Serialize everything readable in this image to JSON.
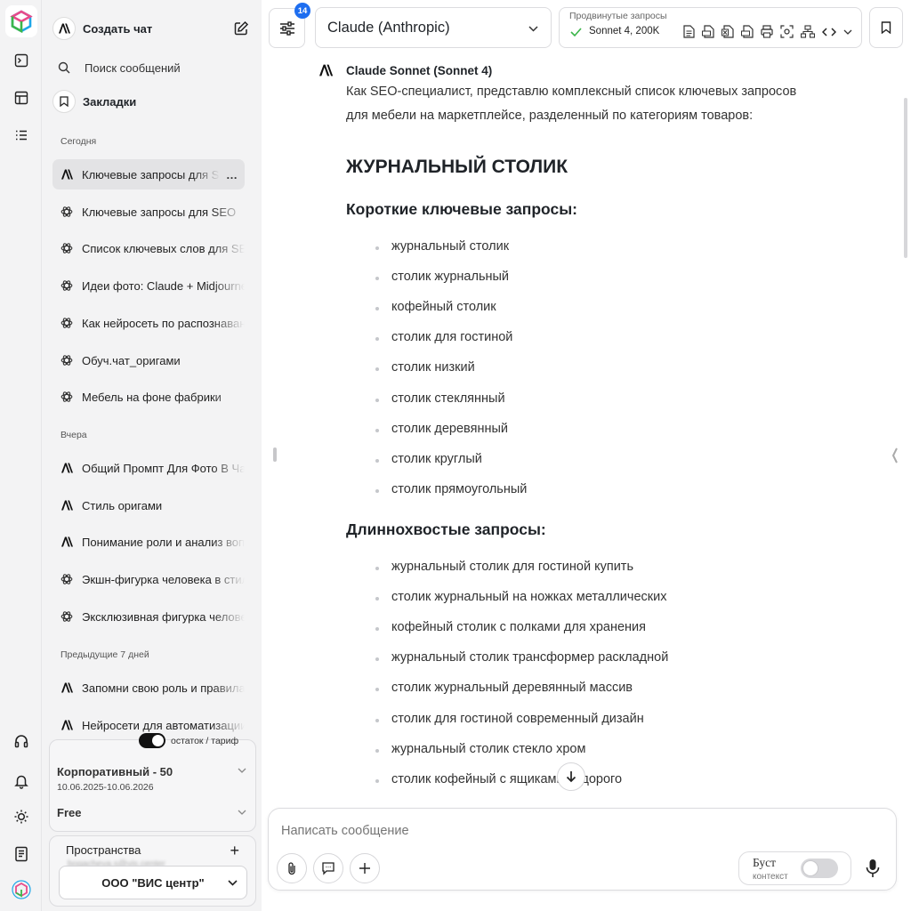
{
  "sidebar": {
    "new_chat_label": "Создать чат",
    "search_label": "Поиск сообщений",
    "bookmarks_label": "Закладки",
    "sections": [
      {
        "label": "Сегодня",
        "items": [
          {
            "label": "Ключевые запросы для SEO",
            "icon": "anthropic-icon",
            "active": true
          },
          {
            "label": "Ключевые запросы для SEO",
            "icon": "openai-icon"
          },
          {
            "label": "Список ключевых слов для SEO",
            "icon": "openai-icon"
          },
          {
            "label": "Идеи фото: Claude + Midjourney",
            "icon": "openai-icon"
          },
          {
            "label": "Как нейросеть по распознаванию",
            "icon": "openai-icon"
          },
          {
            "label": "Обуч.чат_оригами",
            "icon": "openai-icon"
          },
          {
            "label": "Мебель на фоне фабрики",
            "icon": "openai-icon"
          }
        ]
      },
      {
        "label": "Вчера",
        "items": [
          {
            "label": "Общий Промпт Для Фото В Чат",
            "icon": "anthropic-icon"
          },
          {
            "label": "Стиль оригами",
            "icon": "anthropic-icon"
          },
          {
            "label": "Понимание роли и анализ вопроса",
            "icon": "anthropic-icon"
          },
          {
            "label": "Экшн-фигурка человека в стиле",
            "icon": "openai-icon"
          },
          {
            "label": "Эксклюзивная фигурка человека",
            "icon": "openai-icon"
          }
        ]
      },
      {
        "label": "Предыдущие 7 дней",
        "items": [
          {
            "label": "Запомни свою роль и правила",
            "icon": "anthropic-icon"
          },
          {
            "label": "Нейросети для автоматизации",
            "icon": "anthropic-icon"
          }
        ]
      }
    ],
    "plan": {
      "toggle_label": "остаток / тариф",
      "plan_name": "Корпоративный - 50",
      "plan_dates": "10.06.2025-10.06.2026",
      "free_label": "Free"
    },
    "spaces": {
      "title": "Пространства",
      "email": "bogacheva.s@vis.center",
      "org": "ООО \"ВИС центр\""
    }
  },
  "topbar": {
    "settings_badge": "14",
    "model_name": "Claude (Anthropic)",
    "advanced_label": "Продвинутые запросы",
    "advanced_value": "Sonnet 4, 200K"
  },
  "message": {
    "author": "Claude Sonnet (Sonnet 4)",
    "intro_line1": "Как SEO-специалист, представлю комплексный список ключевых запросов",
    "intro_line2": "для мебели на маркетплейсе, разделенный по категориям товаров:",
    "heading": "ЖУРНАЛЬНЫЙ СТОЛИК",
    "short_title": "Короткие ключевые запросы:",
    "short_items": [
      "журнальный столик",
      "столик журнальный",
      "кофейный столик",
      "столик для гостиной",
      "столик низкий",
      "столик стеклянный",
      "столик деревянный",
      "столик круглый",
      "столик прямоугольный"
    ],
    "long_title": "Длиннохвостые запросы:",
    "long_items": [
      "журнальный столик для гостиной купить",
      "столик журнальный на ножках металлических",
      "кофейный столик с полками для хранения",
      "журнальный столик трансформер раскладной",
      "столик журнальный деревянный массив",
      "столик для гостиной современный дизайн",
      "журнальный столик стекло хром",
      "столик кофейный с ящиками недорого"
    ]
  },
  "composer": {
    "placeholder": "Написать сообщение",
    "boost_label": "Буст",
    "boost_sub": "контекст"
  },
  "colors": {
    "accent": "#1e6ef0",
    "sidebar_bg": "#f3f3f4",
    "active_item": "#e3e3e5",
    "check": "#3bb54a"
  }
}
